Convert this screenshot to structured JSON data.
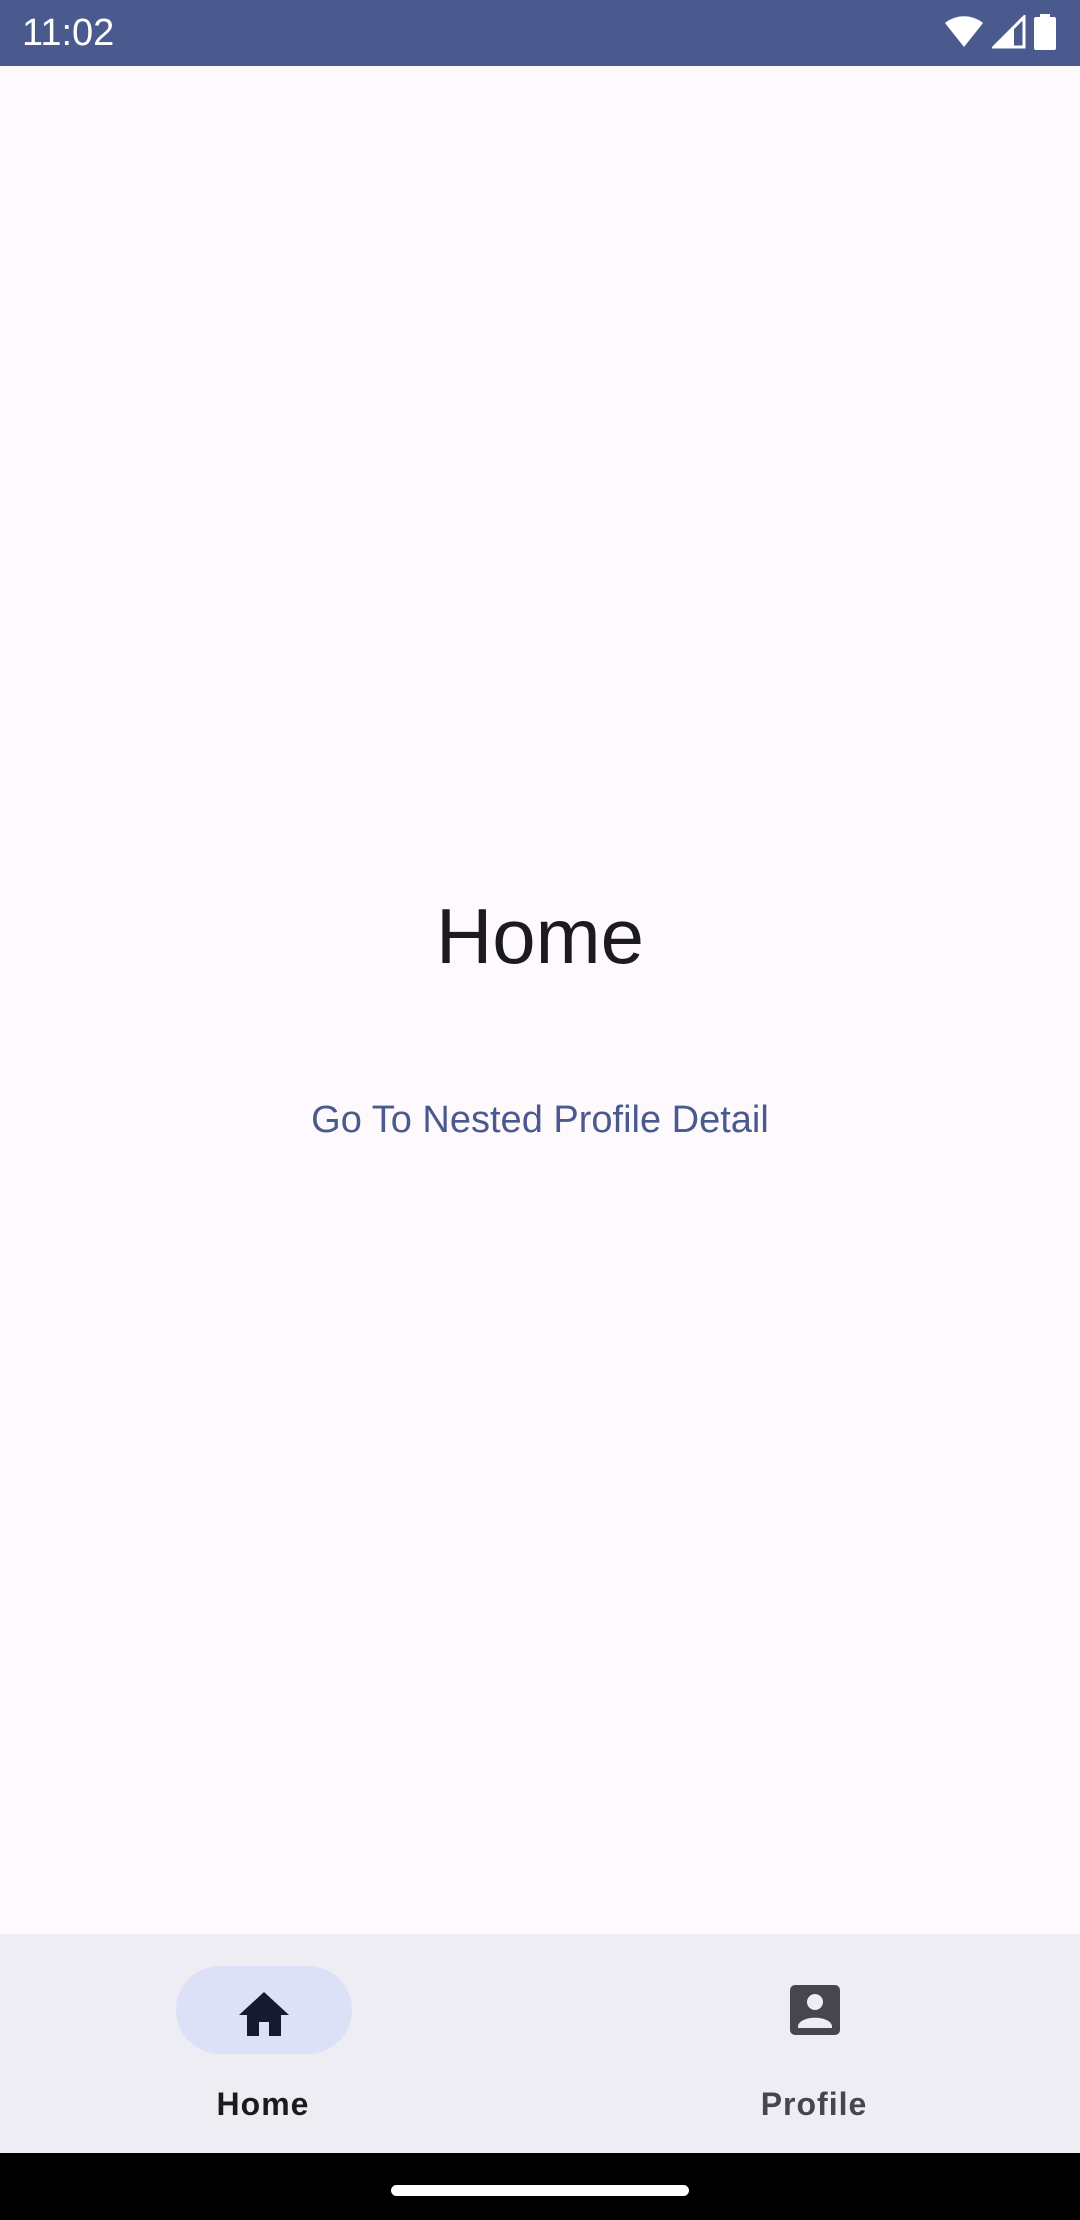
{
  "status_bar": {
    "time": "11:02",
    "icons": [
      "wifi-icon",
      "signal-icon",
      "battery-icon"
    ],
    "background": "#4A5A8E"
  },
  "screen": {
    "title": "Home",
    "link_label": "Go To Nested Profile Detail",
    "accent_color": "#4A5A8E"
  },
  "bottom_nav": {
    "items": [
      {
        "label": "Home",
        "icon": "home-icon",
        "selected": true
      },
      {
        "label": "Profile",
        "icon": "profile-icon",
        "selected": false
      }
    ],
    "background": "#EFEDF4",
    "selected_pill_color": "#DCE1F7"
  }
}
